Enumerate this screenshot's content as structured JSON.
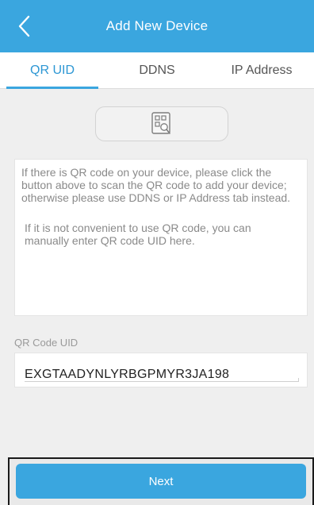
{
  "header": {
    "title": "Add New Device",
    "back_icon": "chevron-left-icon",
    "background": "#3aa6df"
  },
  "tabs": [
    {
      "label": "QR UID",
      "active": true
    },
    {
      "label": "DDNS",
      "active": false
    },
    {
      "label": "IP Address",
      "active": false
    }
  ],
  "scan_button": {
    "icon": "qr-scan-icon"
  },
  "info": {
    "paragraph1": "If there is QR code on your device, please click the button above to scan the QR code to add your device; otherwise please use DDNS or IP Address tab instead.",
    "paragraph2": "If it is not convenient to use QR code, you can manually enter QR code UID here."
  },
  "uid": {
    "label": "QR Code UID",
    "value": "EXGTAADYNLYRBGPMYR3JA198"
  },
  "footer": {
    "next_label": "Next"
  },
  "colors": {
    "accent": "#3aa6df",
    "active_tab_text": "#2d97d4"
  }
}
